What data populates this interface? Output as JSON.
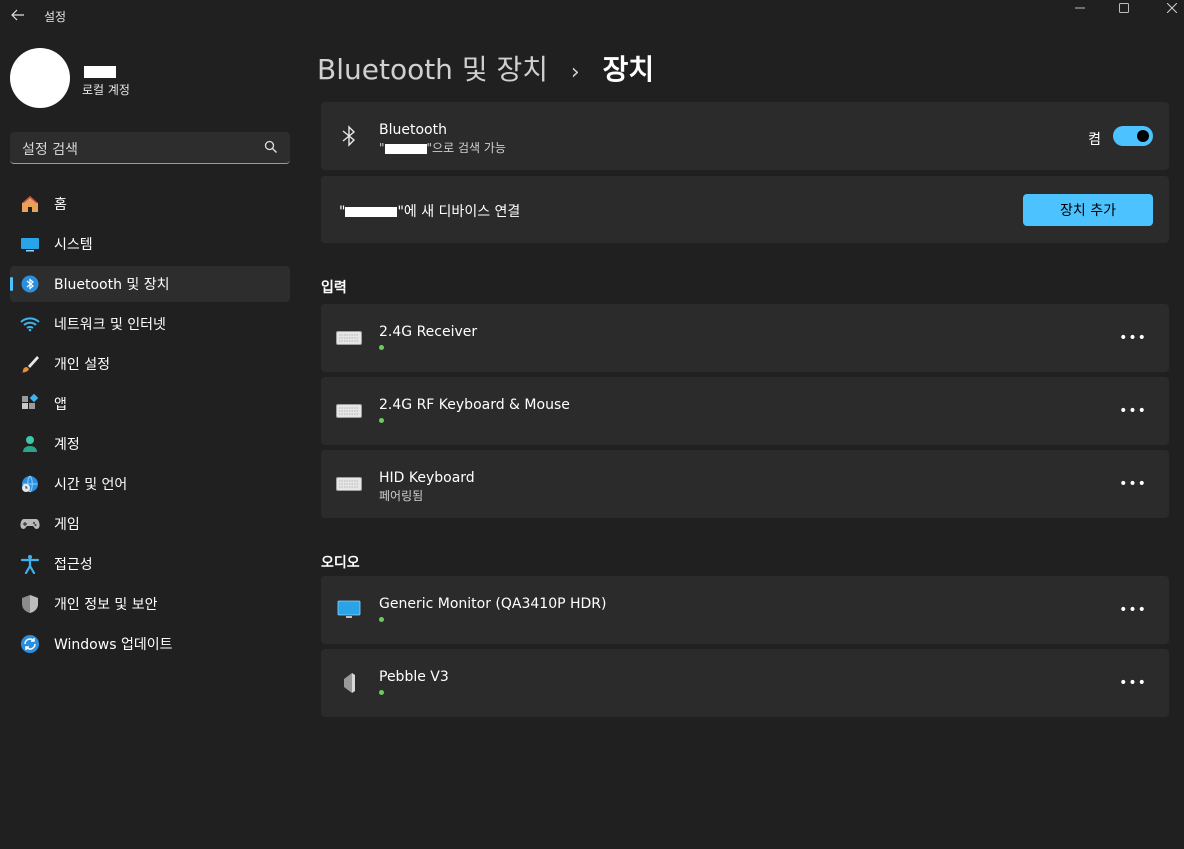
{
  "window": {
    "title": "설정",
    "back_icon": "back-arrow-icon",
    "controls": [
      "minimize-icon",
      "maximize-icon",
      "close-icon"
    ]
  },
  "account": {
    "type": "로컬 계정"
  },
  "search": {
    "placeholder": "설정 검색"
  },
  "sidebar": {
    "items": [
      {
        "label": "홈",
        "icon": "home-icon",
        "selected": false
      },
      {
        "label": "시스템",
        "icon": "system-icon",
        "selected": false
      },
      {
        "label": "Bluetooth 및 장치",
        "icon": "bluetooth-icon",
        "selected": true
      },
      {
        "label": "네트워크 및 인터넷",
        "icon": "wifi-icon",
        "selected": false
      },
      {
        "label": "개인 설정",
        "icon": "brush-icon",
        "selected": false
      },
      {
        "label": "앱",
        "icon": "apps-icon",
        "selected": false
      },
      {
        "label": "계정",
        "icon": "person-icon",
        "selected": false
      },
      {
        "label": "시간 및 언어",
        "icon": "globe-clock-icon",
        "selected": false
      },
      {
        "label": "게임",
        "icon": "gamepad-icon",
        "selected": false
      },
      {
        "label": "접근성",
        "icon": "accessibility-icon",
        "selected": false
      },
      {
        "label": "개인 정보 및 보안",
        "icon": "shield-icon",
        "selected": false
      },
      {
        "label": "Windows 업데이트",
        "icon": "update-icon",
        "selected": false
      }
    ]
  },
  "breadcrumb": {
    "parent": "Bluetooth 및 장치",
    "separator": "›",
    "current": "장치"
  },
  "bluetooth_card": {
    "title": "Bluetooth",
    "subtitle_prefix": "\"",
    "subtitle_suffix": "\"으로 검색 가능",
    "toggle_label": "켬",
    "toggle_on": true
  },
  "connect_card": {
    "prefix": "\"",
    "suffix": "\"에 새 디바이스 연결",
    "button_label": "장치 추가"
  },
  "sections": {
    "input": "입력",
    "audio": "오디오"
  },
  "input_devices": [
    {
      "name": "2.4G Receiver",
      "status": "",
      "connected": true,
      "icon": "keyboard-icon"
    },
    {
      "name": "2.4G RF Keyboard & Mouse",
      "status": "",
      "connected": true,
      "icon": "keyboard-icon"
    },
    {
      "name": "HID Keyboard",
      "status": "페어링됨",
      "connected": false,
      "icon": "keyboard-icon"
    }
  ],
  "audio_devices": [
    {
      "name": "Generic Monitor (QA3410P HDR)",
      "status": "",
      "connected": true,
      "icon": "monitor-icon"
    },
    {
      "name": "Pebble V3",
      "status": "",
      "connected": true,
      "icon": "speaker-icon"
    }
  ],
  "more_label": "•••",
  "colors": {
    "accent": "#4cc2ff",
    "background": "#202020",
    "card": "#2b2b2b",
    "connected_dot": "#6ccb5f"
  }
}
